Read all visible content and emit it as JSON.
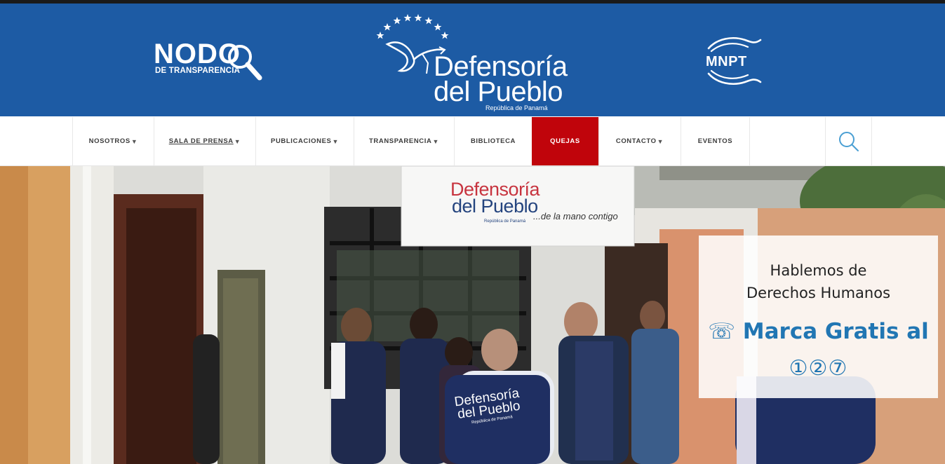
{
  "header": {
    "nodo": {
      "word": "NODO",
      "sub": "DE TRANSPARENCIA",
      "icon": "magnifier-icon"
    },
    "logo": {
      "line1": "Defensoría",
      "line2": "del Pueblo",
      "sub": "República de Panamá",
      "icon": "dove-stars-icon"
    },
    "mnpt": {
      "word": "MNPT",
      "icon": "hands-icon"
    },
    "color": "#1d5ba4"
  },
  "nav": {
    "items": [
      {
        "label": "NOSOTROS",
        "arrow": "▼"
      },
      {
        "label": "SALA DE PRENSA",
        "arrow": "▼"
      },
      {
        "label": "PUBLICACIONES",
        "arrow": "▼"
      },
      {
        "label": "TRANSPARENCIA",
        "arrow": "▼"
      },
      {
        "label": "BIBLIOTECA",
        "arrow": ""
      },
      {
        "label": "QUEJAS",
        "arrow": ""
      },
      {
        "label": "CONTACTO",
        "arrow": "▼"
      },
      {
        "label": "EVENTOS",
        "arrow": ""
      }
    ],
    "active_color": "#c0040b",
    "search_icon": "search-icon"
  },
  "hero": {
    "sign": {
      "line1": "Defensoría",
      "line2": "del Pueblo",
      "sub": "República de Panamá",
      "tagline": "...de la mano contigo"
    },
    "vest_text": {
      "line1": "Defensoría",
      "line2": "del Pueblo",
      "sub": "República de Panamá"
    },
    "callout": {
      "title_line1": "Hablemos de",
      "title_line2": "Derechos Humanos",
      "phone": "☏ Marca Gratis al",
      "number": "①②⑦",
      "accent": "#2176b3"
    }
  }
}
